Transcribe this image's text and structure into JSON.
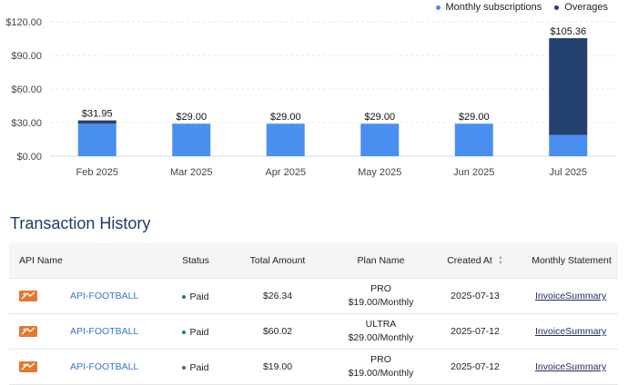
{
  "legend": [
    {
      "label": "Monthly subscriptions",
      "color": "#4a8ff0"
    },
    {
      "label": "Overages",
      "color": "#23406e"
    }
  ],
  "chart_data": {
    "type": "bar",
    "stacked": true,
    "categories": [
      "Feb 2025",
      "Mar 2025",
      "Apr 2025",
      "May 2025",
      "Jun 2025",
      "Jul 2025"
    ],
    "series": [
      {
        "name": "Monthly subscriptions",
        "values": [
          29.0,
          29.0,
          29.0,
          29.0,
          29.0,
          19.0
        ],
        "color": "#4a8ff0"
      },
      {
        "name": "Overages",
        "values": [
          2.95,
          0,
          0,
          0,
          0,
          86.36
        ],
        "color": "#23406e"
      }
    ],
    "totals": [
      "$31.95",
      "$29.00",
      "$29.00",
      "$29.00",
      "$29.00",
      "$105.36"
    ],
    "y_ticks": [
      0,
      30,
      60,
      90,
      120
    ],
    "y_tick_labels": [
      "$0.00",
      "$30.00",
      "$60.00",
      "$90.00",
      "$120.00"
    ],
    "ylim": [
      0,
      120
    ],
    "grid": true,
    "legend_position": "top-right"
  },
  "section_title": "Transaction History",
  "table": {
    "headers": {
      "api_name": "API Name",
      "status": "Status",
      "total_amount": "Total Amount",
      "plan_name": "Plan Name",
      "created_at": "Created At",
      "monthly_statement": "Monthly Statement"
    },
    "rows": [
      {
        "api": "API-FOOTBALL",
        "status": "Paid",
        "amount": "$26.34",
        "plan": "PRO",
        "price": "$19.00/Monthly",
        "created": "2025-07-13",
        "invoice": "Invoice",
        "summary": "Summary"
      },
      {
        "api": "API-FOOTBALL",
        "status": "Paid",
        "amount": "$60.02",
        "plan": "ULTRA",
        "price": "$29.00/Monthly",
        "created": "2025-07-12",
        "invoice": "Invoice",
        "summary": "Summary"
      },
      {
        "api": "API-FOOTBALL",
        "status": "Paid",
        "amount": "$19.00",
        "plan": "PRO",
        "price": "$19.00/Monthly",
        "created": "2025-07-12",
        "invoice": "Invoice",
        "summary": "Summary"
      }
    ]
  }
}
